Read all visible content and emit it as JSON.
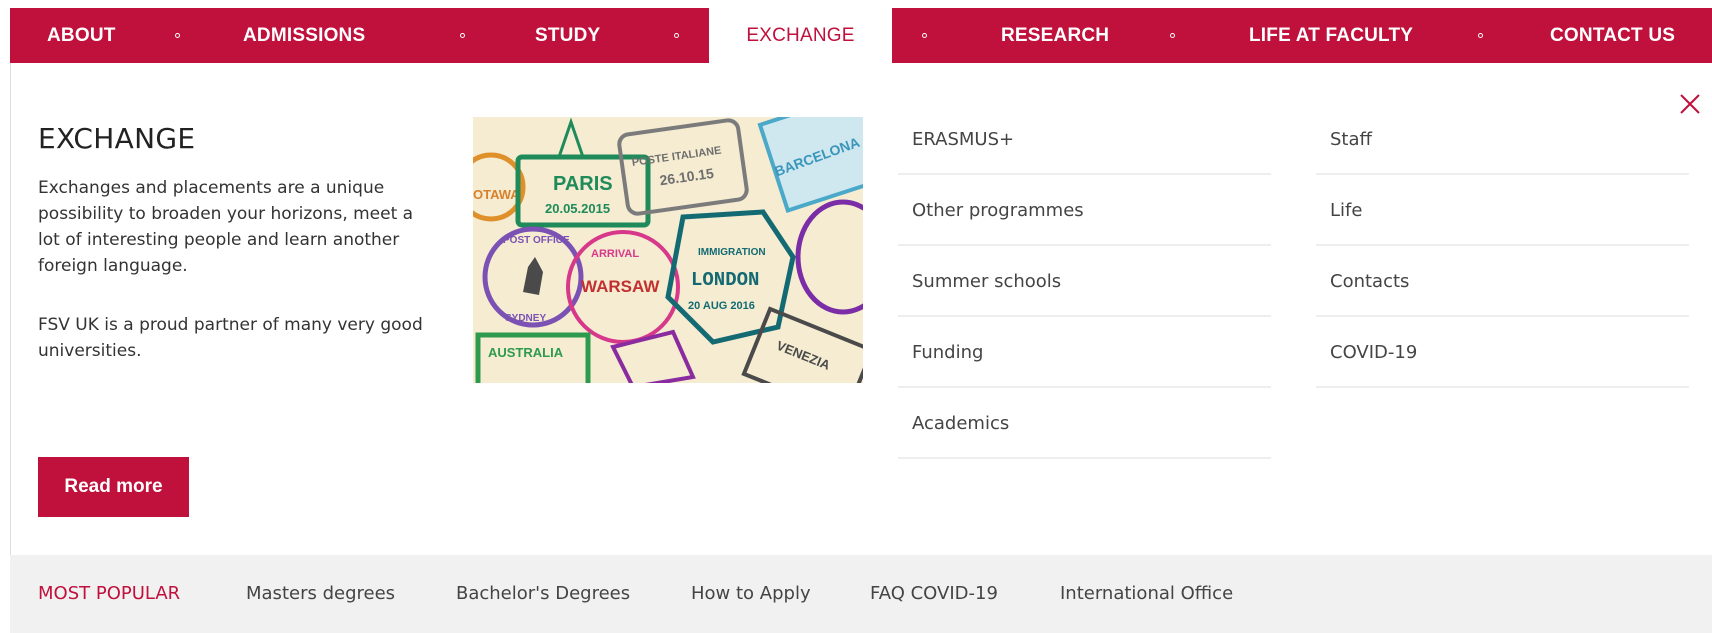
{
  "nav": {
    "items": [
      {
        "label": "ABOUT"
      },
      {
        "label": "ADMISSIONS"
      },
      {
        "label": "STUDY"
      },
      {
        "label": "EXCHANGE",
        "active": true
      },
      {
        "label": "RESEARCH"
      },
      {
        "label": "LIFE AT FACULTY"
      },
      {
        "label": "CONTACT US"
      }
    ]
  },
  "exchange": {
    "title": "EXCHANGE",
    "description": "Exchanges and placements are a unique possibility to broaden your horizons, meet a lot of interesting people and learn another foreign language.",
    "description2": "FSV UK is a proud partner of many very good universities.",
    "read_more": "Read more",
    "image_alt": "Passport stamps collage",
    "stamps": {
      "paris": "PARIS",
      "paris_date": "20.05.2015",
      "poste": "POSTE ITALIANE",
      "poste_date": "26.10.15",
      "london": "LONDON",
      "london_date": "20 AUG 2016",
      "immigration": "IMMIGRATION",
      "warsaw": "WARSAW",
      "arrival": "ARRIVAL",
      "australia": "AUSTRALIA",
      "sydney": "SYDNEY",
      "barcelona": "BARCELONA",
      "venezia": "VENEZIA",
      "post_office": "POST OFFICE",
      "otawa": "OTAWA"
    }
  },
  "links": {
    "col1": [
      {
        "label": "ERASMUS+"
      },
      {
        "label": "Other programmes"
      },
      {
        "label": "Summer schools"
      },
      {
        "label": "Funding"
      },
      {
        "label": "Academics"
      }
    ],
    "col2": [
      {
        "label": "Staff"
      },
      {
        "label": "Life"
      },
      {
        "label": "Contacts"
      },
      {
        "label": "COVID-19"
      }
    ]
  },
  "bottom": {
    "label": "MOST POPULAR",
    "items": [
      {
        "label": "Masters degrees"
      },
      {
        "label": "Bachelor's Degrees"
      },
      {
        "label": "How to Apply"
      },
      {
        "label": "FAQ COVID-19"
      },
      {
        "label": "International Office"
      }
    ]
  },
  "colors": {
    "accent": "#c0103c",
    "bottom_bar": "#f1f1f1",
    "divider": "#eeeeee"
  },
  "icons": {
    "close": "close-icon",
    "nav_separator": "dot-icon"
  }
}
